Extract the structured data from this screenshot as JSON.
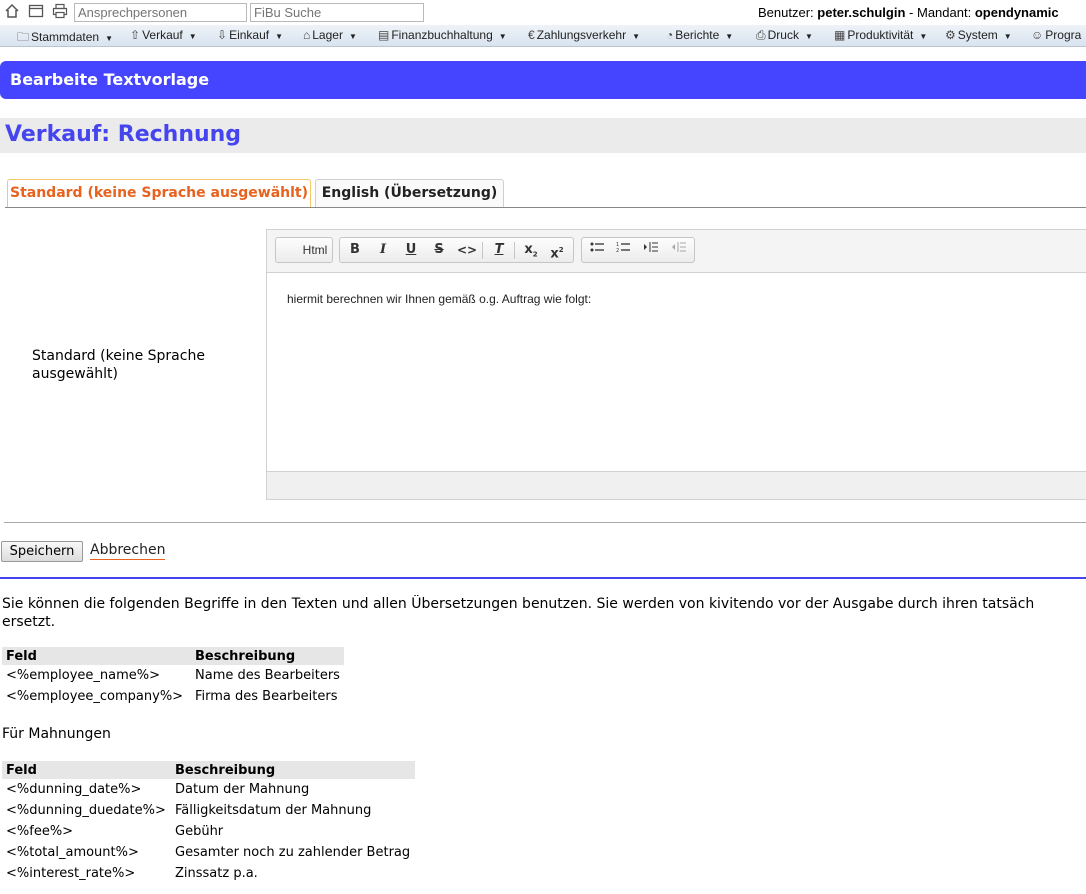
{
  "topbar": {
    "search_contacts_placeholder": "Ansprechpersonen",
    "fibu_search_placeholder": "FiBu Suche",
    "user_label": "Benutzer:",
    "user_name": "peter.schulgin",
    "client_label": "- Mandant:",
    "client_name": "opendynamic"
  },
  "menu": [
    {
      "label": "Stammdaten",
      "icon": "folder-icon"
    },
    {
      "label": "Verkauf",
      "icon": "upload-icon"
    },
    {
      "label": "Einkauf",
      "icon": "download-icon"
    },
    {
      "label": "Lager",
      "icon": "warehouse-icon"
    },
    {
      "label": "Finanzbuchhaltung",
      "icon": "ledger-icon"
    },
    {
      "label": "Zahlungsverkehr",
      "icon": "euro-icon"
    },
    {
      "label": "Berichte",
      "icon": "pie-chart-icon"
    },
    {
      "label": "Druck",
      "icon": "printer-icon"
    },
    {
      "label": "Produktivität",
      "icon": "calendar-icon"
    },
    {
      "label": "System",
      "icon": "gear-icon"
    },
    {
      "label": "Progra",
      "icon": "user-icon"
    }
  ],
  "header": {
    "title": "Bearbeite Textvorlage"
  },
  "page": {
    "title": "Verkauf: Rechnung"
  },
  "tabs": [
    {
      "label": "Standard (keine Sprache ausgewählt)",
      "active": true
    },
    {
      "label": "English (Übersetzung)",
      "active": false
    }
  ],
  "form": {
    "field_label": "Standard (keine Sprache ausgewählt)",
    "editor_content": "hiermit berechnen wir Ihnen gemäß o.g. Auftrag wie folgt:",
    "toolbar": {
      "html_label": "Html",
      "bold": "B",
      "italic": "I",
      "underline": "U",
      "strike": "S",
      "code": "<>",
      "clear": "T",
      "subscript": "x",
      "superscript": "x"
    }
  },
  "actions": {
    "save_label": "Speichern",
    "cancel_label": "Abbrechen"
  },
  "info": {
    "line1": "Sie können die folgenden Begriffe in den Texten und allen Übersetzungen benutzen. Sie werden von kivitendo vor der Ausgabe durch ihren tatsäch",
    "line2": "ersetzt."
  },
  "table1": {
    "headers": [
      "Feld",
      "Beschreibung"
    ],
    "rows": [
      [
        "<%employee_name%>",
        "Name des Bearbeiters"
      ],
      [
        "<%employee_company%>",
        "Firma des Bearbeiters"
      ]
    ]
  },
  "section2": {
    "label": "Für Mahnungen"
  },
  "table2": {
    "headers": [
      "Feld",
      "Beschreibung"
    ],
    "rows": [
      [
        "<%dunning_date%>",
        "Datum der Mahnung"
      ],
      [
        "<%dunning_duedate%>",
        "Fälligkeitsdatum der Mahnung"
      ],
      [
        "<%fee%>",
        "Gebühr"
      ],
      [
        "<%total_amount%>",
        "Gesamter noch zu zahlender Betrag"
      ],
      [
        "<%interest_rate%>",
        "Zinssatz p.a."
      ]
    ]
  }
}
